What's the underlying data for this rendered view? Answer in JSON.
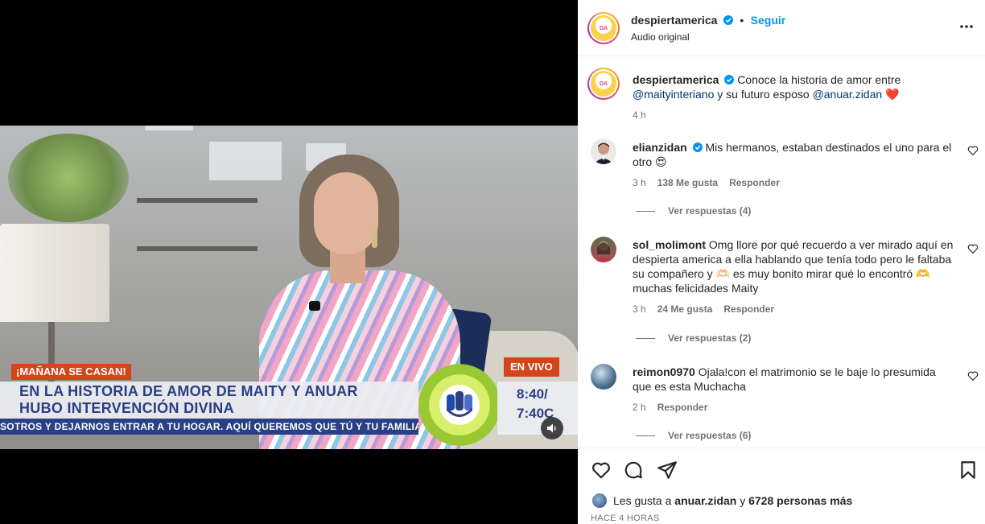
{
  "video": {
    "label_top": "¡MAÑANA SE CASAN!",
    "headline_1": "EN LA HISTORIA DE AMOR DE MAITY Y ANUAR",
    "headline_2": "HUBO INTERVENCIÓN DIVINA",
    "ticker": "SOTROS Y DEJARNOS ENTRAR A TU HOGAR. AQUÍ QUEREMOS QUE TÚ Y TU FAMILIA PR",
    "live": "EN VIVO",
    "time_1": "8:40/",
    "time_2": "7:40C",
    "mute_icon": "speaker-icon"
  },
  "header": {
    "username": "despiertamerica",
    "follow": "Seguir",
    "dot": "•",
    "audio": "Audio original",
    "more_icon": "more-horizontal-icon"
  },
  "caption": {
    "username": "despiertamerica",
    "text_1": "Conoce la historia de amor entre",
    "mention_1": "@maityinteriano",
    "text_2": "y su futuro esposo",
    "mention_2": "@anuar.zidan",
    "emoji": "❤️",
    "time": "4 h"
  },
  "comments": [
    {
      "username": "elianzidan",
      "verified": true,
      "text": "Mis hermanos, estaban destinados el uno para el otro 😍",
      "time": "3 h",
      "likes": "138 Me gusta",
      "reply": "Responder",
      "view_replies": "Ver respuestas (4)"
    },
    {
      "username": "sol_molimont",
      "verified": false,
      "text": "Omg llore por qué recuerdo a ver mirado aquí en despierta america a ella hablando que tenía todo pero le faltaba su compañero y 🫶🏻 es muy bonito mirar qué lo encontró 🫶 muchas felicidades Maity",
      "time": "3 h",
      "likes": "24 Me gusta",
      "reply": "Responder",
      "view_replies": "Ver respuestas (2)"
    },
    {
      "username": "reimon0970",
      "verified": false,
      "text": "Ojala!con el matrimonio se le baje lo presumida que es esta Muchacha",
      "time": "2 h",
      "likes": "",
      "reply": "Responder",
      "view_replies": "Ver respuestas (6)"
    }
  ],
  "actions": {
    "like_icon": "heart-icon",
    "comment_icon": "comment-icon",
    "share_icon": "send-icon",
    "save_icon": "bookmark-icon",
    "likes_prefix": "Les gusta a",
    "likes_user": "anuar.zidan",
    "likes_mid": "y",
    "likes_count": "6728 personas más",
    "posted": "HACE 4 HORAS"
  },
  "colors": {
    "accent_blue": "#0095f6",
    "mention": "#00376b",
    "broadcast_red": "#d2461a",
    "broadcast_navy": "#2a3f86"
  }
}
